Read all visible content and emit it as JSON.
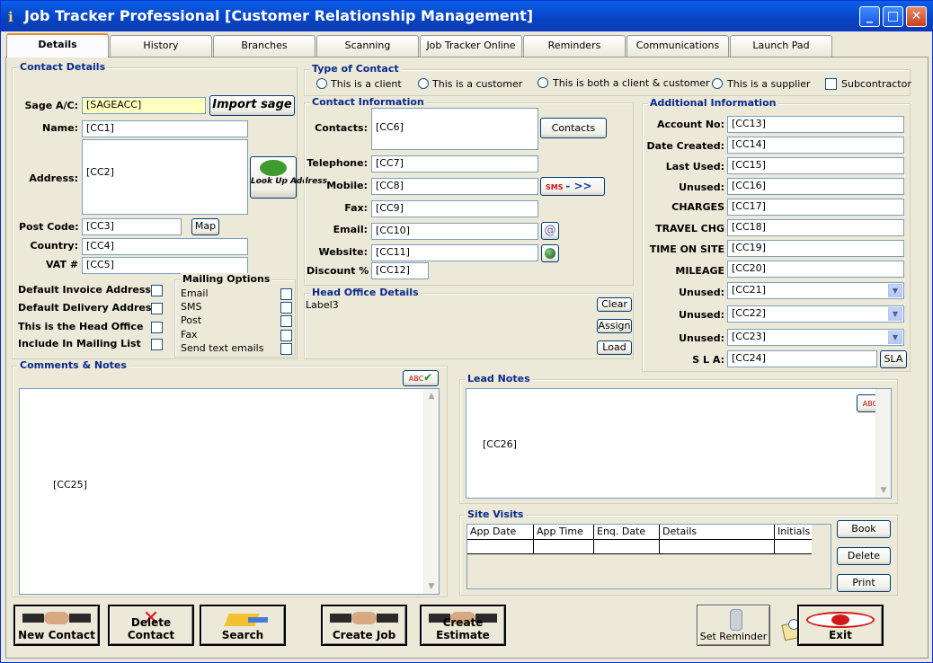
{
  "window": {
    "title": "Job Tracker Professional [Customer Relationship Management]"
  },
  "tabs": [
    "Details",
    "History",
    "Branches",
    "Scanning",
    "Job Tracker Online",
    "Reminders",
    "Communications",
    "Launch Pad"
  ],
  "contact_details": {
    "title": "Contact Details",
    "sage_label": "Sage A/C:",
    "sage_value": "[SAGEACC]",
    "import_sage_label": "Import sage",
    "name_label": "Name:",
    "name_value": "[CC1]",
    "address_label": "Address:",
    "address_value": "[CC2]",
    "lookup_label": "Look Up Address",
    "postcode_label": "Post Code:",
    "postcode_value": "[CC3]",
    "map_label": "Map",
    "country_label": "Country:",
    "country_value": "[CC4]",
    "vat_label": "VAT #",
    "vat_value": "[CC5]",
    "default_invoice": "Default Invoice Address",
    "default_delivery": "Default Delivery Address",
    "head_office": "This is the Head Office",
    "include_mailing": "Include In Mailing List",
    "mailing_title": "Mailing Options",
    "mailing_options": [
      "Email",
      "SMS",
      "Post",
      "Fax",
      "Send text emails"
    ]
  },
  "type_of_contact": {
    "title": "Type of Contact",
    "options": [
      "This is a client",
      "This is a customer",
      "This is both a client & customer",
      "This is a supplier"
    ],
    "subcontractor": "Subcontractor"
  },
  "contact_info": {
    "title": "Contact Information",
    "contacts_label": "Contacts:",
    "contacts_value": "[CC6]",
    "contacts_button": "Contacts",
    "telephone_label": "Telephone:",
    "telephone_value": "[CC7]",
    "mobile_label": "Mobile:",
    "mobile_value": "[CC8]",
    "sms_button": "SMS",
    "fax_label": "Fax:",
    "fax_value": "[CC9]",
    "email_label": "Email:",
    "email_value": "[CC10]",
    "website_label": "Website:",
    "website_value": "[CC11]",
    "discount_label": "Discount %",
    "discount_value": "[CC12]"
  },
  "head_office": {
    "title": "Head Office Details",
    "label": "Label3",
    "clear": "Clear",
    "assign": "Assign",
    "load": "Load"
  },
  "additional_info": {
    "title": "Additional Information",
    "rows": [
      {
        "label": "Account No:",
        "value": "[CC13]"
      },
      {
        "label": "Date Created:",
        "value": "[CC14]"
      },
      {
        "label": "Last Used:",
        "value": "[CC15]"
      },
      {
        "label": "Unused:",
        "value": "[CC16]"
      },
      {
        "label": "CHARGES",
        "value": "[CC17]"
      },
      {
        "label": "TRAVEL CHG",
        "value": "[CC18]"
      },
      {
        "label": "TIME ON SITE",
        "value": "[CC19]"
      },
      {
        "label": "MILEAGE",
        "value": "[CC20]"
      }
    ],
    "dropdowns": [
      {
        "label": "Unused:",
        "value": "[CC21]"
      },
      {
        "label": "Unused:",
        "value": "[CC22]"
      },
      {
        "label": "Unused:",
        "value": "[CC23]"
      }
    ],
    "sla_label": "S L A:",
    "sla_value": "[CC24]",
    "sla_button": "SLA"
  },
  "comments": {
    "title": "Comments & Notes",
    "value": "[CC25]",
    "spell_label": "ABC"
  },
  "lead_notes": {
    "title": "Lead Notes",
    "value": "[CC26]",
    "spell_label": "ABC"
  },
  "site_visits": {
    "title": "Site Visits",
    "columns": [
      "App Date",
      "App Time",
      "Enq. Date",
      "Details",
      "Initials"
    ],
    "book": "Book",
    "delete": "Delete",
    "print": "Print"
  },
  "bottom_buttons": {
    "new_contact": "New Contact",
    "delete_contact": "Delete Contact",
    "search": "Search",
    "create_job": "Create Job",
    "create_estimate": "Create Estimate",
    "set_reminder": "Set Reminder",
    "exit": "Exit"
  }
}
